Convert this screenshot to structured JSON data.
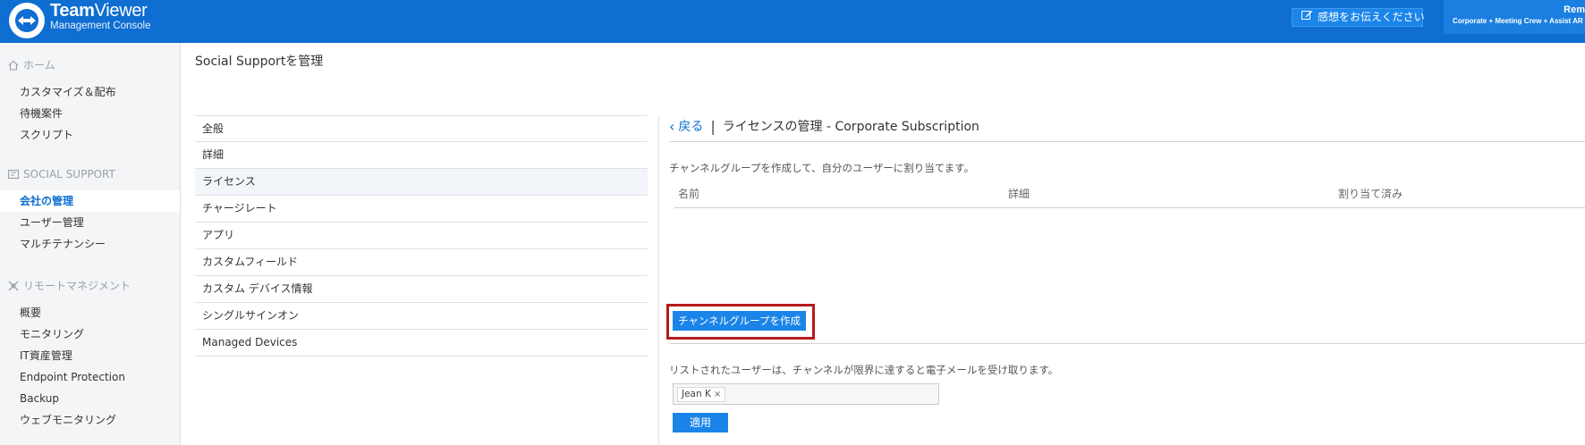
{
  "app": {
    "brand_name_bold": "Team",
    "brand_name_light": "Viewer",
    "brand_sub": "Management Console",
    "feedback_label": "感想をお伝えください",
    "account_name": "Rem",
    "account_plan": "Corporate + Meeting Crew + Assist AR P"
  },
  "sidebar": {
    "sections": [
      {
        "header": "ホーム",
        "icon": "home-icon",
        "items": [
          "カスタマイズ＆配布",
          "待機案件",
          "スクリプト"
        ]
      },
      {
        "header": "SOCIAL SUPPORT",
        "icon": "social-support-icon",
        "items": [
          "会社の管理",
          "ユーザー管理",
          "マルチテナンシー"
        ]
      },
      {
        "header": "リモートマネジメント",
        "icon": "remote-management-icon",
        "items": [
          "概要",
          "モニタリング",
          "IT資産管理",
          "Endpoint Protection",
          "Backup",
          "ウェブモニタリング"
        ]
      }
    ],
    "active_item": "会社の管理"
  },
  "main": {
    "page_title": "Social Supportを管理",
    "settings_list": [
      "全般",
      "詳細",
      "ライセンス",
      "チャージレート",
      "アプリ",
      "カスタムフィールド",
      "カスタム デバイス情報",
      "シングルサインオン",
      "Managed Devices"
    ],
    "selected_setting": "ライセンス",
    "back_label": "戻る",
    "breadcrumb_sep": "|",
    "section_title": "ライセンスの管理 - Corporate Subscription",
    "channel_desc": "チャンネルグループを作成して、自分のユーザーに割り当てます。",
    "table_columns": [
      "名前",
      "詳細",
      "割り当て済み"
    ],
    "create_button": "チャンネルグループを作成",
    "notify_desc": "リストされたユーザーは、チャンネルが限界に達すると電子メールを受け取ります。",
    "email_tags": [
      "Jean K"
    ],
    "tag_remove": "×",
    "apply_button": "適用"
  },
  "colors": {
    "topbar": "#0e6ed1",
    "accent": "#1b84e8",
    "highlight_border": "#b51b1b"
  }
}
